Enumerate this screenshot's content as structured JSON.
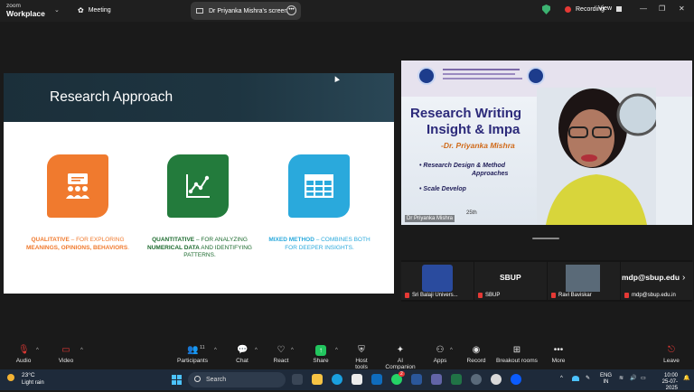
{
  "topbar": {
    "brand_line1": "zoom",
    "brand_line2": "Workplace",
    "meeting_label": "Meeting",
    "tab_label": "Dr Priyanka Mishra's screen",
    "recording_label": "Recording",
    "view_label": "View"
  },
  "slide": {
    "title": "Research Approach",
    "items": [
      {
        "title": "QUALITATIVE",
        "text_a": " – FOR EXPLORING ",
        "bold_b": "MEANINGS, OPINIONS, BEHAVIORS",
        "text_c": ".",
        "color": "#f07a2e",
        "icon": "team-presentation-icon"
      },
      {
        "title": "QUANTITATIVE",
        "text_a": " – FOR ANALYZING ",
        "bold_b": "NUMERICAL DATA",
        "text_c": " AND IDENTIFYING PATTERNS.",
        "color": "#237b3c",
        "icon": "line-chart-icon"
      },
      {
        "title": "MIXED METHOD",
        "text_a": " – COMBINES BOTH FOR DEEPER INSIGHTS.",
        "bold_b": "",
        "text_c": "",
        "color": "#2aa9dc",
        "icon": "table-grid-icon"
      }
    ]
  },
  "video": {
    "heading1": "Research Writing",
    "heading2": "Insight & Impa",
    "author": "-Dr. Priyanka Mishra",
    "bullet1": "Research Design & Method",
    "bullet1b": "Approaches",
    "bullet2": "Scale Develop",
    "date_fragment": "25th",
    "name_label": "Dr Priyanka Mishra"
  },
  "participants_strip": [
    {
      "label": "Sri Balaji Univers...",
      "big": ""
    },
    {
      "label": "SBUP",
      "big": "SBUP"
    },
    {
      "label": "Ravi Baviskar",
      "big": ""
    },
    {
      "label": "mdp@sbup.edu.in",
      "big": "mdp@sbup.edu"
    }
  ],
  "toolbar": {
    "audio": "Audio",
    "video": "Video",
    "participants": "Participants",
    "participants_count": "11",
    "chat": "Chat",
    "react": "React",
    "share": "Share",
    "host_tools": "Host tools",
    "ai_companion": "AI Companion",
    "apps": "Apps",
    "record": "Record",
    "breakout": "Breakout rooms",
    "more": "More",
    "leave": "Leave"
  },
  "taskbar": {
    "temperature": "23°C",
    "weather": "Light rain",
    "search_placeholder": "Search",
    "lang1": "ENG",
    "lang2": "IN",
    "time": "10:00",
    "date": "25-07-2025",
    "notif_count": "2"
  },
  "colors": {
    "accent_green": "#3cb371",
    "record_red": "#e53935",
    "share_green": "#22c55e"
  }
}
